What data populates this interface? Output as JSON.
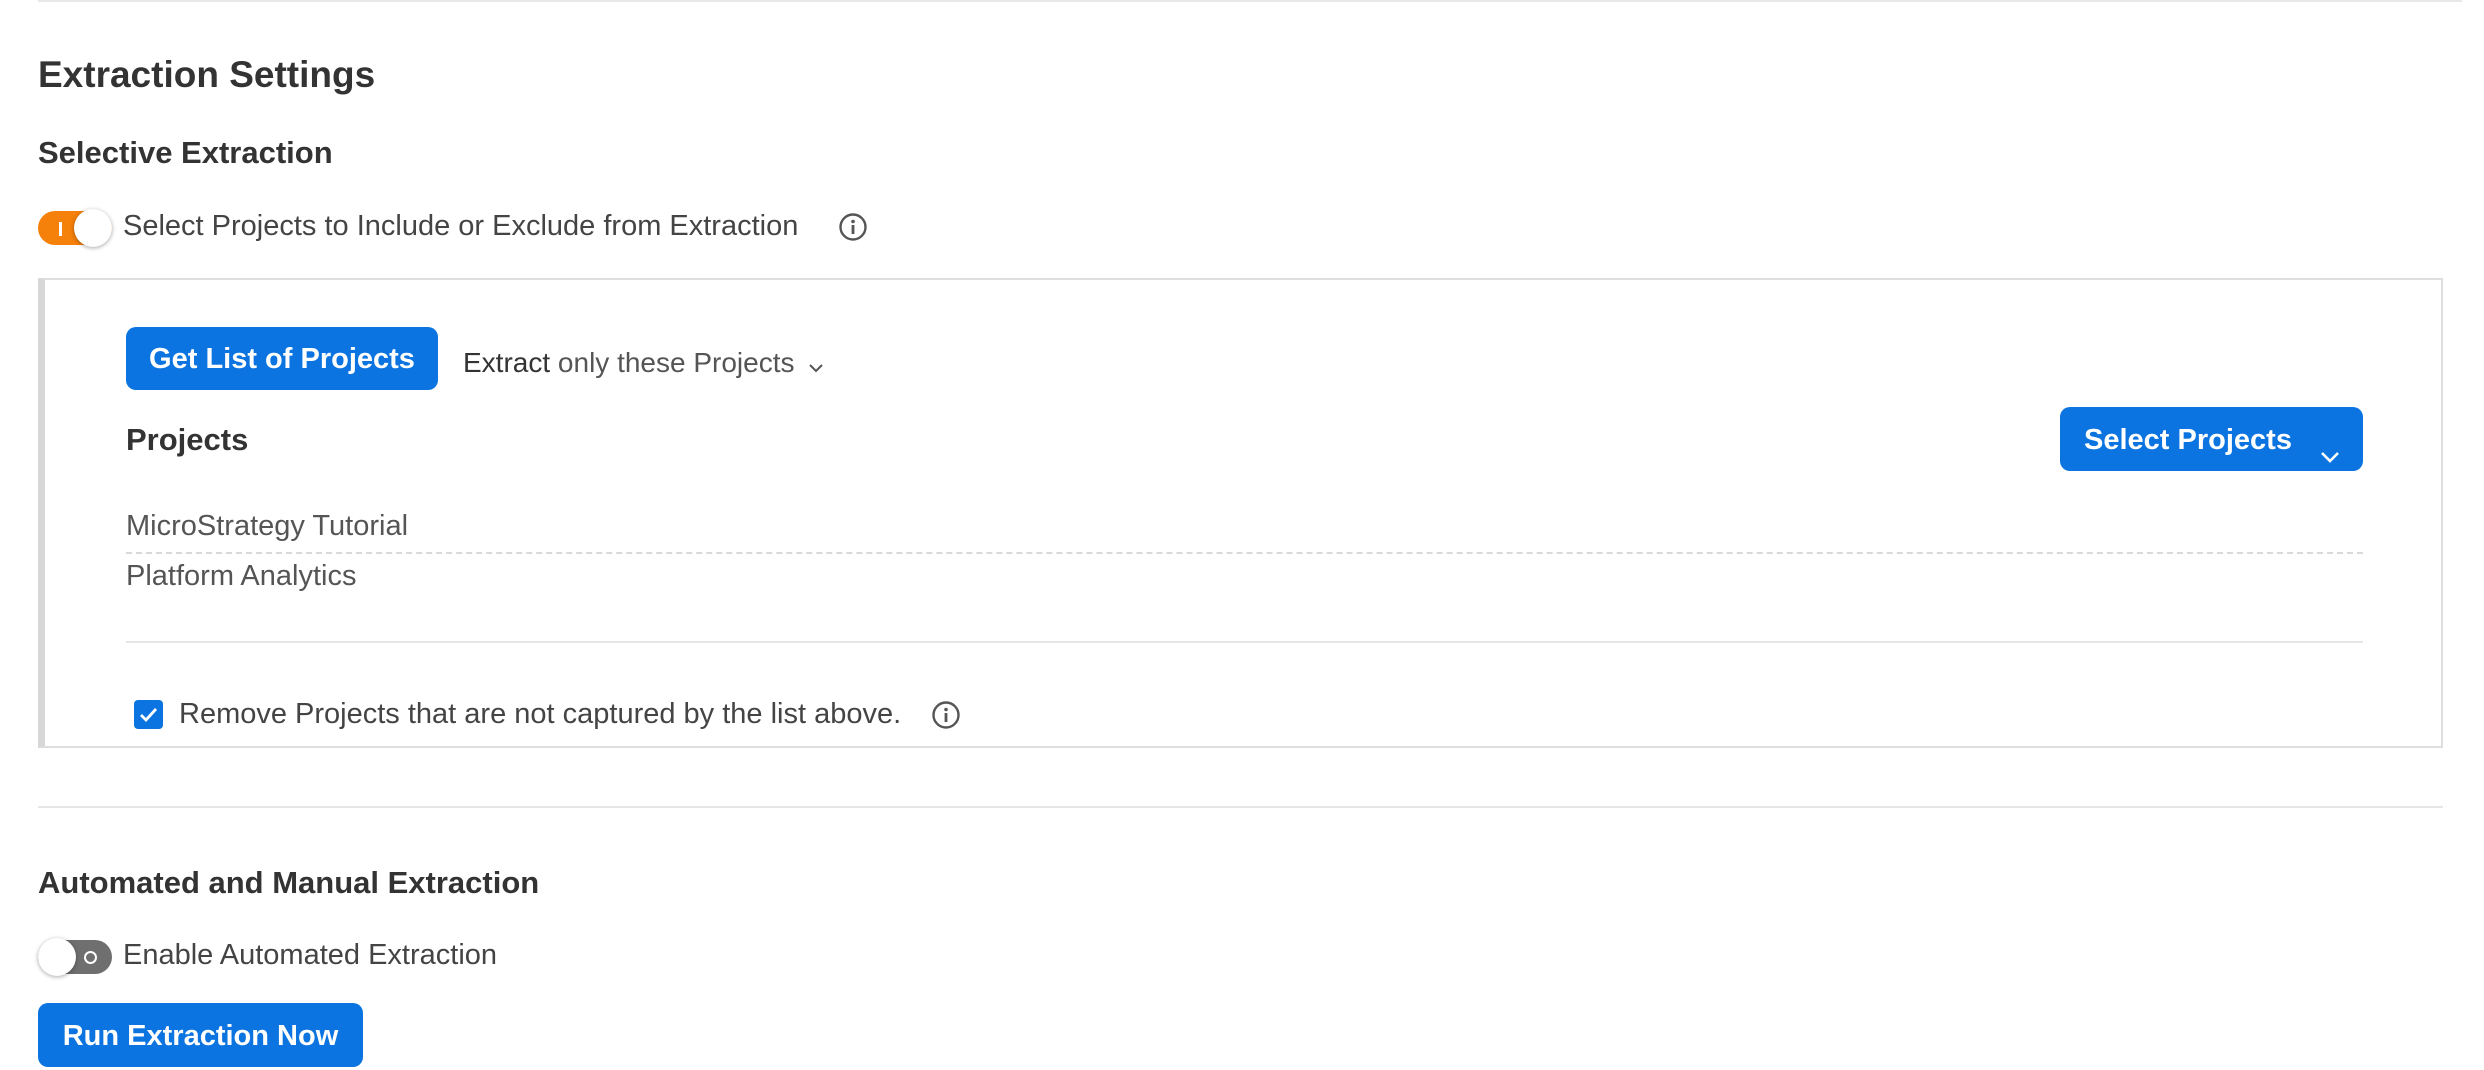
{
  "extraction_settings": {
    "title": "Extraction Settings",
    "selective": {
      "heading": "Selective Extraction",
      "toggle_label": "Select Projects to Include or Exclude from Extraction",
      "toggle_state": "on"
    },
    "panel": {
      "get_list_button": "Get List of Projects",
      "extract_dropdown_prefix": "Extract",
      "extract_dropdown_value": "only these Projects",
      "projects_heading": "Projects",
      "select_projects_button": "Select Projects",
      "projects": [
        "MicroStrategy Tutorial",
        "Platform Analytics"
      ],
      "remove_checkbox_label": "Remove Projects that are not captured by the list above.",
      "remove_checkbox_checked": true
    },
    "automated": {
      "heading": "Automated and Manual Extraction",
      "toggle_label": "Enable Automated Extraction",
      "toggle_state": "off",
      "run_button": "Run Extraction Now"
    }
  },
  "colors": {
    "accent": "#0b74e0",
    "toggle_on": "#f5800a",
    "toggle_off": "#6f6f6f"
  }
}
